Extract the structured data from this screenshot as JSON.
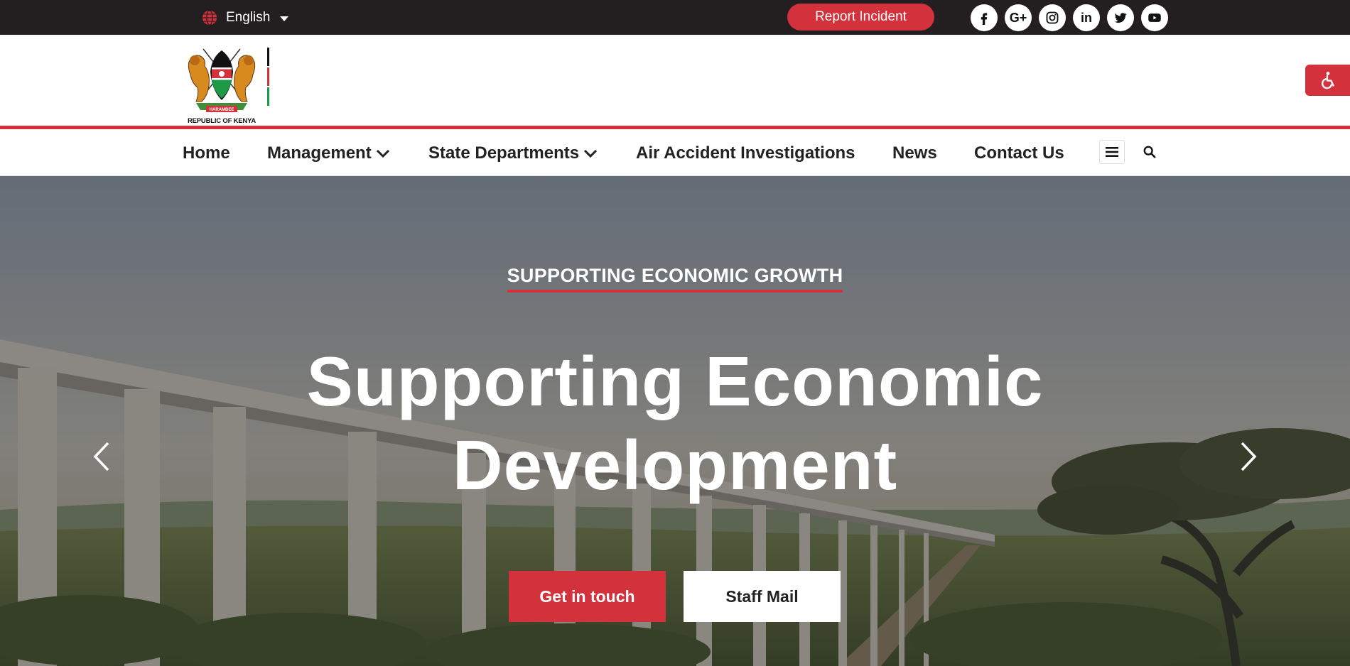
{
  "topbar": {
    "language": "English",
    "report_button": "Report Incident",
    "social_links": [
      "facebook-icon",
      "google-plus-icon",
      "instagram-icon",
      "linkedin-icon",
      "twitter-icon",
      "youtube-icon"
    ],
    "google_plus_text": "G+",
    "linkedin_text": "in"
  },
  "header": {
    "logo_caption": "REPUBLIC OF KENYA",
    "logo_motto": "HARAMBEE"
  },
  "nav": {
    "items": [
      {
        "label": "Home"
      },
      {
        "label": "Management"
      },
      {
        "label": "State Departments"
      },
      {
        "label": "Air Accident Investigations"
      },
      {
        "label": "News"
      },
      {
        "label": "Contact Us"
      }
    ]
  },
  "hero": {
    "eyebrow": "SUPPORTING ECONOMIC GROWTH",
    "headline_line1": "Supporting Economic",
    "headline_line2": "Development",
    "cta_primary": "Get in touch",
    "cta_secondary": "Staff Mail"
  },
  "colors": {
    "accent": "#d3313c",
    "topbar_bg": "#231f20",
    "flag_black": "#111111",
    "flag_red": "#d3313c",
    "flag_green": "#1d9a47"
  }
}
